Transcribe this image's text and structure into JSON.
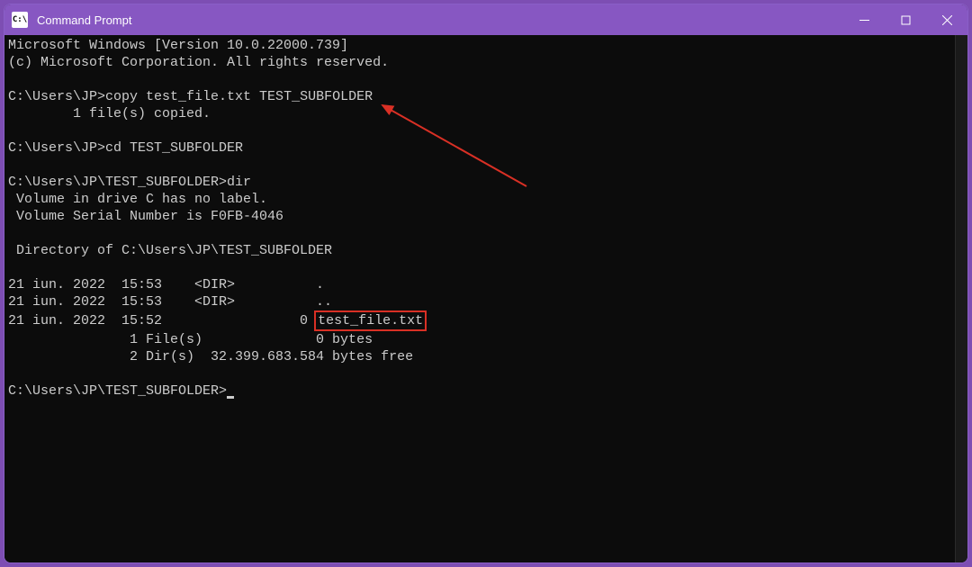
{
  "window": {
    "title": "Command Prompt"
  },
  "terminal": {
    "line1": "Microsoft Windows [Version 10.0.22000.739]",
    "line2": "(c) Microsoft Corporation. All rights reserved.",
    "blank1": "",
    "prompt1_path": "C:\\Users\\JP>",
    "prompt1_cmd": "copy test_file.txt TEST_SUBFOLDER",
    "copy_result": "        1 file(s) copied.",
    "blank2": "",
    "prompt2_path": "C:\\Users\\JP>",
    "prompt2_cmd": "cd TEST_SUBFOLDER",
    "blank3": "",
    "prompt3_path": "C:\\Users\\JP\\TEST_SUBFOLDER>",
    "prompt3_cmd": "dir",
    "vol1": " Volume in drive C has no label.",
    "vol2": " Volume Serial Number is F0FB-4046",
    "blank4": "",
    "dirof": " Directory of C:\\Users\\JP\\TEST_SUBFOLDER",
    "blank5": "",
    "entry1": "21 iun. 2022  15:53    <DIR>          .",
    "entry2": "21 iun. 2022  15:53    <DIR>          ..",
    "entry3_pre": "21 iun. 2022  15:52                 0 ",
    "entry3_file": "test_file.txt",
    "summary1": "               1 File(s)              0 bytes",
    "summary2": "               2 Dir(s)  32.399.683.584 bytes free",
    "blank6": "",
    "prompt4_path": "C:\\Users\\JP\\TEST_SUBFOLDER>"
  }
}
